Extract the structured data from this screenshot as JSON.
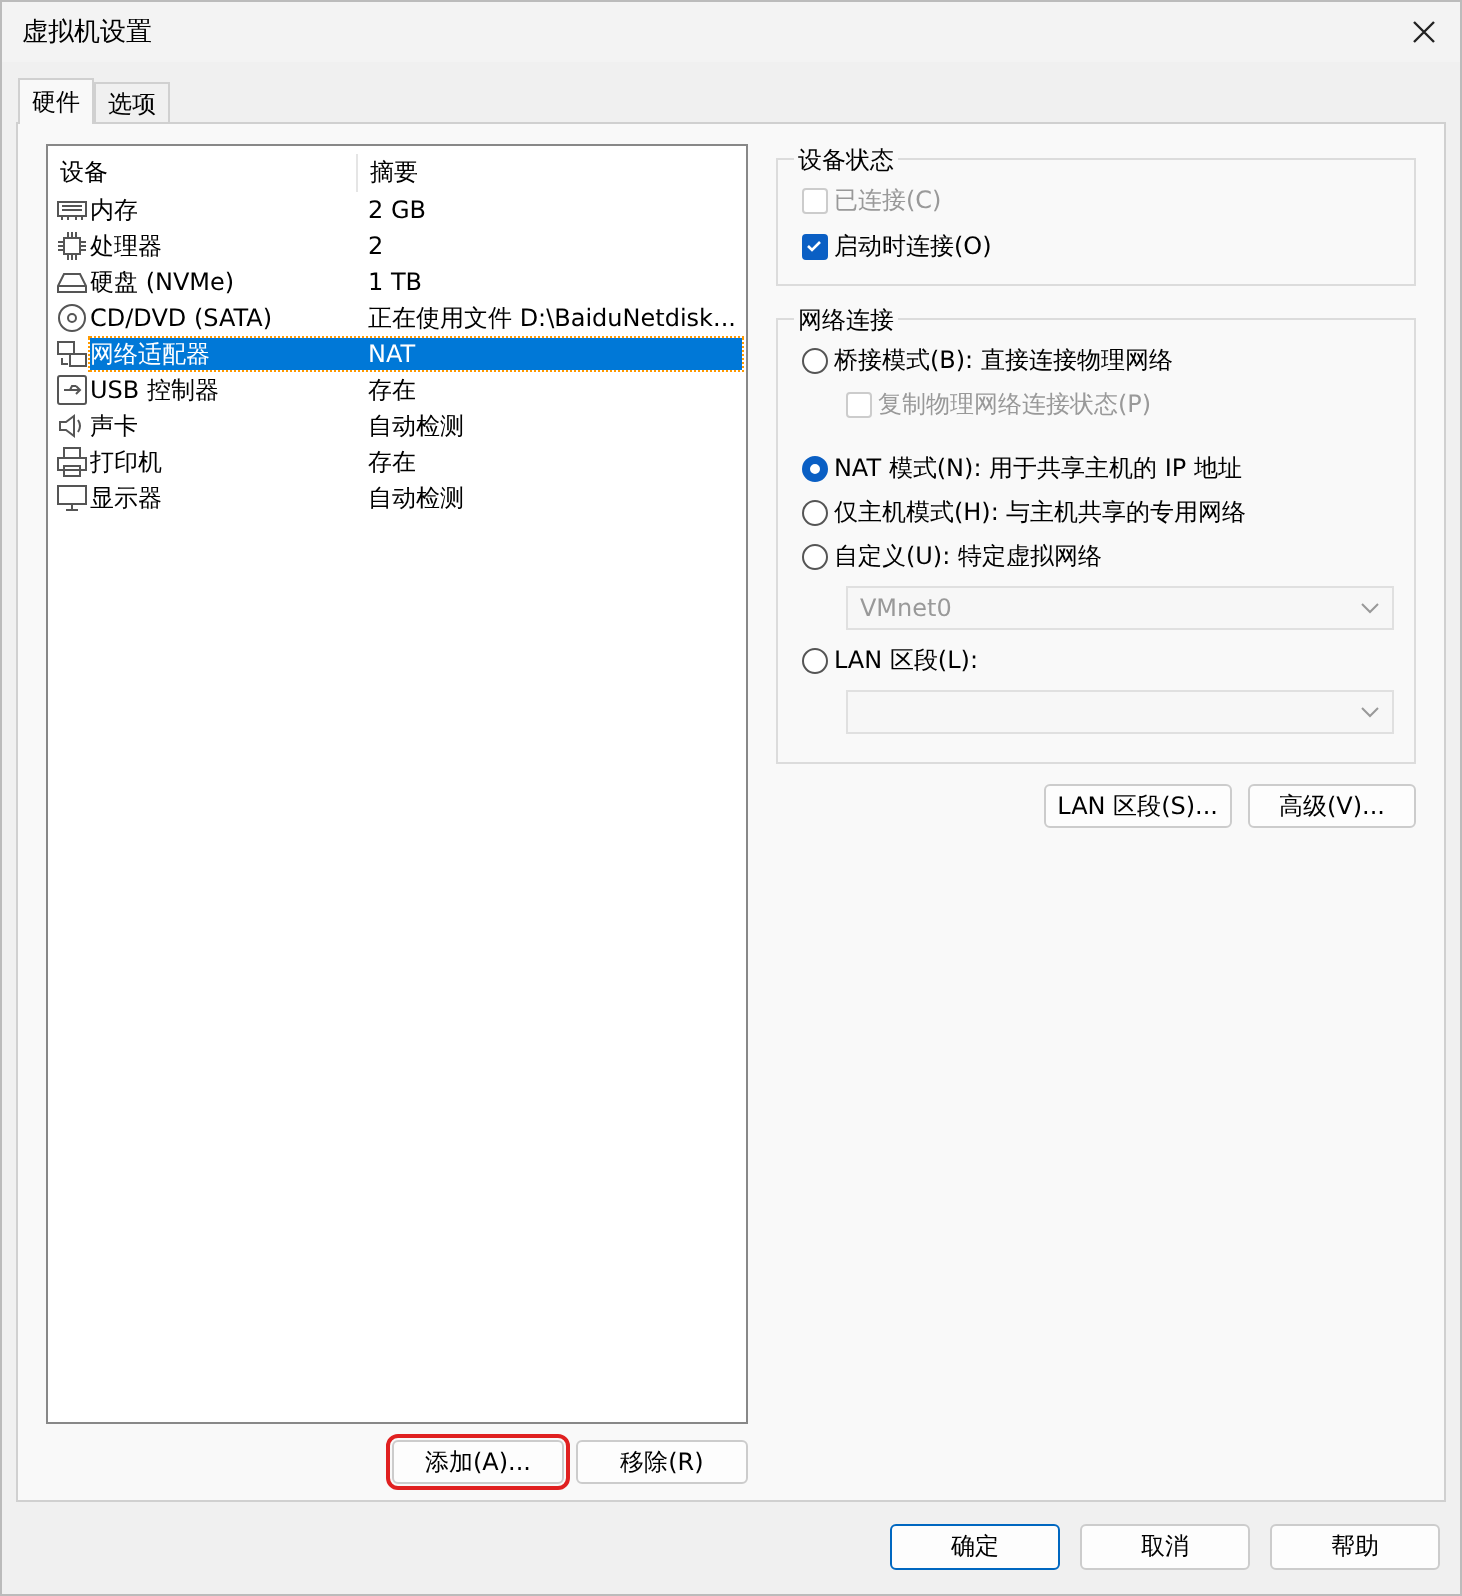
{
  "window": {
    "title": "虚拟机设置"
  },
  "tabs": [
    {
      "label": "硬件",
      "selected": true
    },
    {
      "label": "选项",
      "selected": false
    }
  ],
  "devices": {
    "columns": [
      "设备",
      "摘要"
    ],
    "rows": [
      {
        "kind": "memory",
        "device": "内存",
        "summary": "2 GB",
        "selected": false
      },
      {
        "kind": "cpu",
        "device": "处理器",
        "summary": "2",
        "selected": false
      },
      {
        "kind": "disk",
        "device": "硬盘 (NVMe)",
        "summary": "1 TB",
        "selected": false
      },
      {
        "kind": "cd",
        "device": "CD/DVD (SATA)",
        "summary": "正在使用文件 D:\\BaiduNetdisk...",
        "selected": false
      },
      {
        "kind": "network",
        "device": "网络适配器",
        "summary": "NAT",
        "selected": true
      },
      {
        "kind": "usb",
        "device": "USB 控制器",
        "summary": "存在",
        "selected": false
      },
      {
        "kind": "sound",
        "device": "声卡",
        "summary": "自动检测",
        "selected": false
      },
      {
        "kind": "printer",
        "device": "打印机",
        "summary": "存在",
        "selected": false
      },
      {
        "kind": "display",
        "device": "显示器",
        "summary": "自动检测",
        "selected": false
      }
    ]
  },
  "list_buttons": [
    {
      "label": "添加(A)...",
      "annotated": true
    },
    {
      "label": "移除(R)",
      "annotated": false
    }
  ],
  "device_status": {
    "title": "设备状态",
    "options": [
      {
        "label": "已连接(C)",
        "checked": false,
        "disabled": true
      },
      {
        "label": "启动时连接(O)",
        "checked": true,
        "disabled": false
      }
    ]
  },
  "network_connection": {
    "title": "网络连接",
    "options": [
      {
        "kind": "radio",
        "label": "桥接模式(B): 直接连接物理网络",
        "selected": false,
        "disabled": false
      },
      {
        "kind": "checkbox",
        "label": "复制物理网络连接状态(P)",
        "checked": false,
        "disabled": true
      },
      {
        "kind": "radio",
        "label": "NAT 模式(N): 用于共享主机的 IP 地址",
        "selected": true,
        "disabled": false
      },
      {
        "kind": "radio",
        "label": "仅主机模式(H): 与主机共享的专用网络",
        "selected": false,
        "disabled": false
      },
      {
        "kind": "radio",
        "label": "自定义(U): 特定虚拟网络",
        "selected": false,
        "disabled": false
      },
      {
        "kind": "select",
        "value": "VMnet0",
        "disabled": true
      },
      {
        "kind": "radio",
        "label": "LAN 区段(L):",
        "selected": false,
        "disabled": false
      },
      {
        "kind": "select",
        "disabled": true
      }
    ]
  },
  "network_buttons": [
    "LAN 区段(S)...",
    "高级(V)..."
  ],
  "dialog_buttons": [
    {
      "label": "确定",
      "default": true
    },
    {
      "label": "取消",
      "default": false
    },
    {
      "label": "帮助",
      "default": false
    }
  ]
}
